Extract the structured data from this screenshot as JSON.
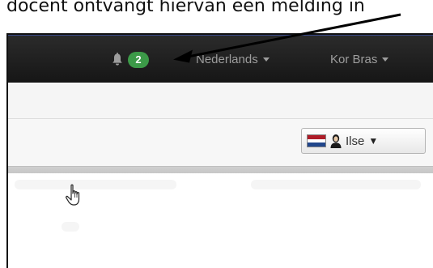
{
  "caption": {
    "text": "docent ontvangt hiervan een melding in"
  },
  "navbar": {
    "notifications": {
      "icon": "bell-icon",
      "count": "2",
      "badge_color": "#3c9a48"
    },
    "language_menu": {
      "label": "Nederlands",
      "icon": "caret-down-icon"
    },
    "user_menu": {
      "label": "Kor Bras",
      "icon": "caret-down-icon"
    }
  },
  "toolbar": {
    "student_selector": {
      "flag_icon": "netherlands-flag-icon",
      "person_icon": "person-icon",
      "label": "Ilse",
      "caret": "▼"
    }
  },
  "colors": {
    "navbar_bg": "#1f1f1f",
    "nav_text": "#9d9d9d",
    "badge_green": "#3c9a48"
  }
}
